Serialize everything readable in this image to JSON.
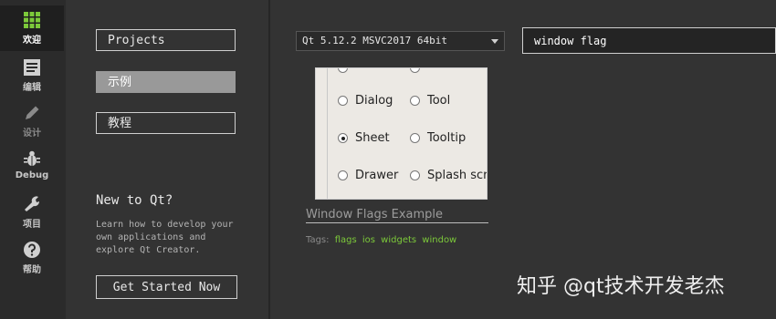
{
  "modes": [
    {
      "label": "欢迎",
      "icon": "grid-icon",
      "state": "active"
    },
    {
      "label": "编辑",
      "icon": "document-icon",
      "state": "normal"
    },
    {
      "label": "设计",
      "icon": "pencil-icon",
      "state": "dim"
    },
    {
      "label": "Debug",
      "icon": "bug-icon",
      "state": "normal"
    },
    {
      "label": "项目",
      "icon": "wrench-icon",
      "state": "normal"
    },
    {
      "label": "帮助",
      "icon": "help-icon",
      "state": "normal"
    }
  ],
  "nav": {
    "projects": "Projects",
    "examples": "示例",
    "tutorials": "教程"
  },
  "newToQt": {
    "title": "New to Qt?",
    "line1": "Learn how to develop your",
    "line2": "own applications and",
    "line3": "explore Qt Creator.",
    "button": "Get Started Now"
  },
  "kit": {
    "selected": "Qt 5.12.2 MSVC2017 64bit"
  },
  "search": {
    "value": "window flag"
  },
  "example": {
    "title": "Window Flags Example",
    "thumbnail": {
      "options": [
        {
          "label": "Dialog",
          "checked": false
        },
        {
          "label": "Tool",
          "checked": false
        },
        {
          "label": "Sheet",
          "checked": true
        },
        {
          "label": "Tooltip",
          "checked": false
        },
        {
          "label": "Drawer",
          "checked": false
        },
        {
          "label": "Splash scre",
          "checked": false
        }
      ]
    },
    "tagsLabel": "Tags:",
    "tags": [
      "flags",
      "ios",
      "widgets",
      "window"
    ]
  },
  "watermark": "知乎 @qt技术开发老杰",
  "colors": {
    "accentGreen": "#7cc93a",
    "background": "#333333",
    "selectedNav": "#999999"
  }
}
